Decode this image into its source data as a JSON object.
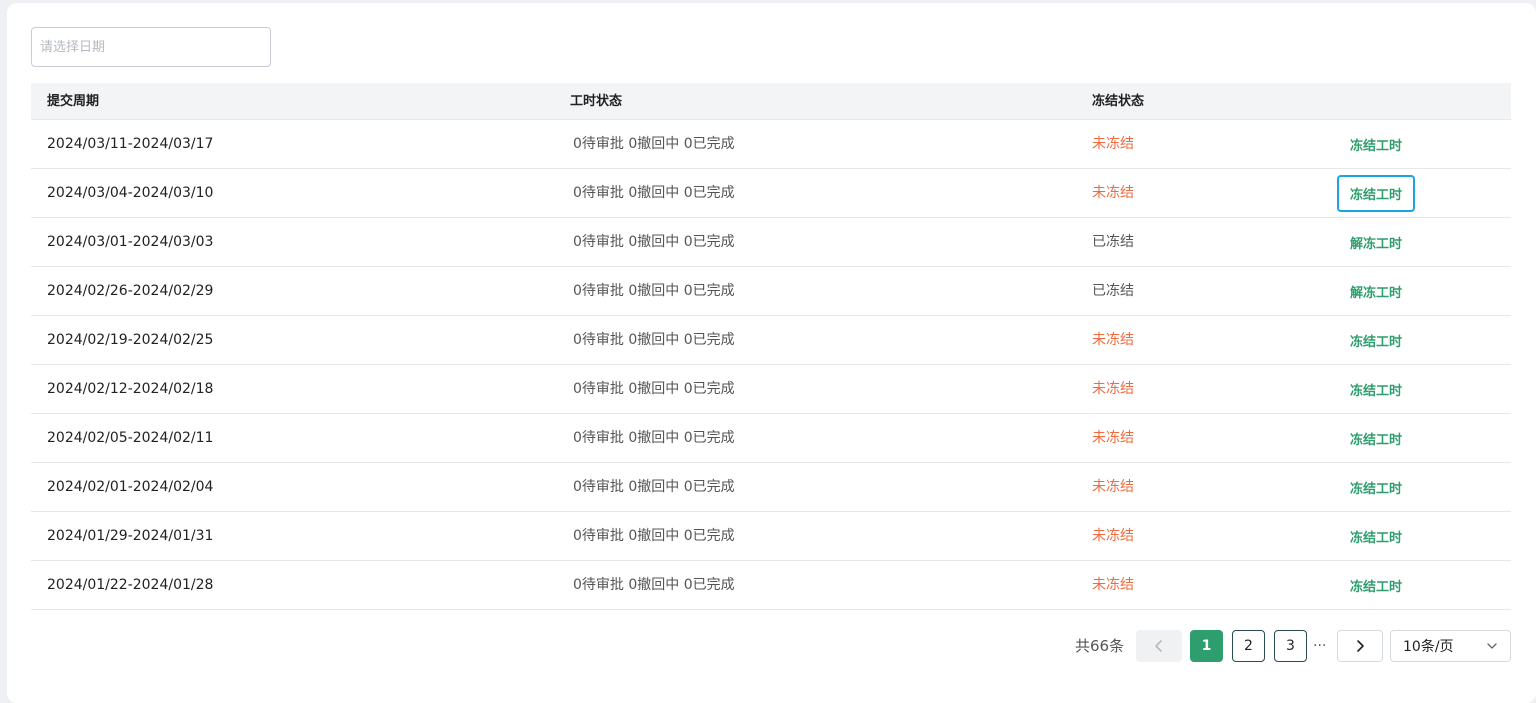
{
  "filter": {
    "date_placeholder": "请选择日期"
  },
  "table": {
    "headers": {
      "period": "提交周期",
      "hours_status": "工时状态",
      "freeze_status": "冻结状态"
    },
    "rows": [
      {
        "period": "2024/03/11-2024/03/17",
        "hours_status": "0待审批 0撤回中 0已完成",
        "freeze_status": "未冻结",
        "action": "冻结工时"
      },
      {
        "period": "2024/03/04-2024/03/10",
        "hours_status": "0待审批 0撤回中 0已完成",
        "freeze_status": "未冻结",
        "action": "冻结工时"
      },
      {
        "period": "2024/03/01-2024/03/03",
        "hours_status": "0待审批 0撤回中 0已完成",
        "freeze_status": "已冻结",
        "action": "解冻工时"
      },
      {
        "period": "2024/02/26-2024/02/29",
        "hours_status": "0待审批 0撤回中 0已完成",
        "freeze_status": "已冻结",
        "action": "解冻工时"
      },
      {
        "period": "2024/02/19-2024/02/25",
        "hours_status": "0待审批 0撤回中 0已完成",
        "freeze_status": "未冻结",
        "action": "冻结工时"
      },
      {
        "period": "2024/02/12-2024/02/18",
        "hours_status": "0待审批 0撤回中 0已完成",
        "freeze_status": "未冻结",
        "action": "冻结工时"
      },
      {
        "period": "2024/02/05-2024/02/11",
        "hours_status": "0待审批 0撤回中 0已完成",
        "freeze_status": "未冻结",
        "action": "冻结工时"
      },
      {
        "period": "2024/02/01-2024/02/04",
        "hours_status": "0待审批 0撤回中 0已完成",
        "freeze_status": "未冻结",
        "action": "冻结工时"
      },
      {
        "period": "2024/01/29-2024/01/31",
        "hours_status": "0待审批 0撤回中 0已完成",
        "freeze_status": "未冻结",
        "action": "冻结工时"
      },
      {
        "period": "2024/01/22-2024/01/28",
        "hours_status": "0待审批 0撤回中 0已完成",
        "freeze_status": "未冻结",
        "action": "冻结工时"
      }
    ]
  },
  "pagination": {
    "total": "共66条",
    "pages": [
      "1",
      "2",
      "3"
    ],
    "active_page": "1",
    "ellipsis": "···",
    "page_size": "10条/页",
    "prev_icon": "chevron-left-icon",
    "next_icon": "chevron-right-icon",
    "dropdown_icon": "chevron-down-icon"
  },
  "colors": {
    "accent": "#2f9e6e",
    "unfrozen": "#ef6a3e",
    "frozen": "#555555",
    "focus_ring": "#1aa3e0"
  }
}
